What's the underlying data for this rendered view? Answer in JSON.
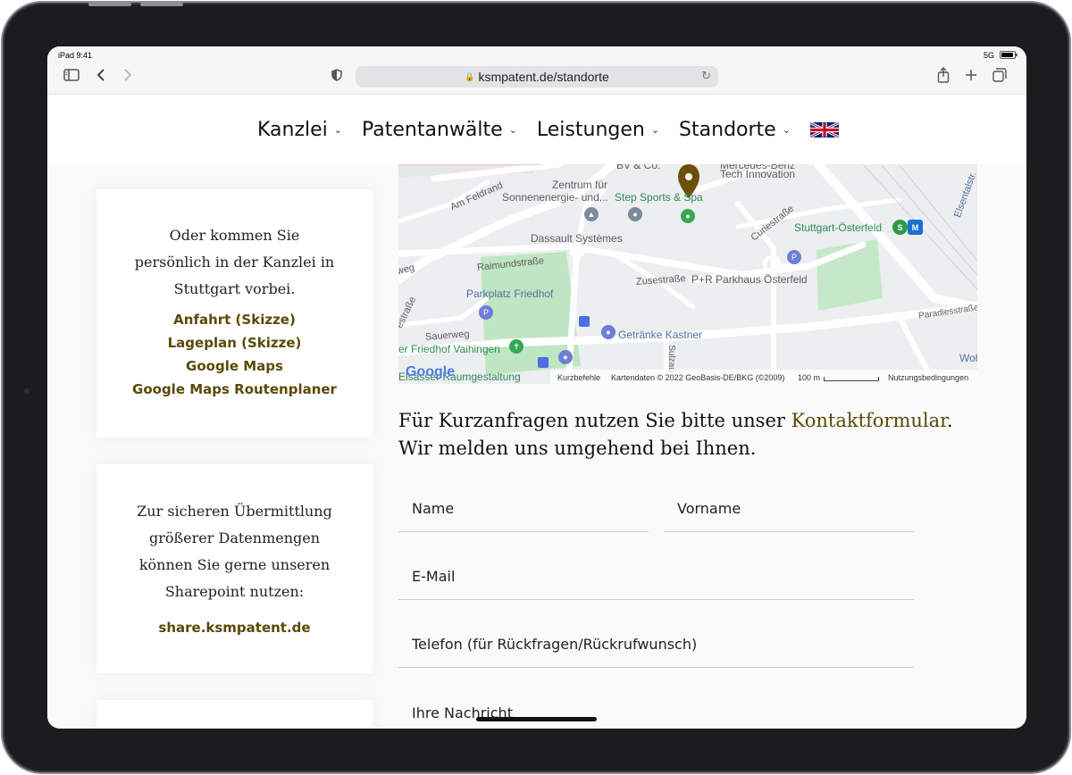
{
  "status": {
    "time": "iPad 9:41",
    "network": "5G"
  },
  "browser": {
    "url": "ksmpatent.de/standorte"
  },
  "nav": {
    "items": [
      {
        "label": "Kanzlei"
      },
      {
        "label": "Patentanwälte"
      },
      {
        "label": "Leistungen"
      },
      {
        "label": "Standorte"
      }
    ]
  },
  "visit_card": {
    "text": "Oder kommen Sie persönlich in der Kanzlei in Stuttgart vorbei.",
    "links": [
      "Anfahrt (Skizze)",
      "Lageplan (Skizze)",
      "Google Maps",
      "Google Maps Routenplaner"
    ]
  },
  "share_card": {
    "text": "Zur sicheren Übermittlung größerer Datenmengen können Sie gerne unseren Sharepoint nutzen:",
    "link": "share.ksmpatent.de"
  },
  "map": {
    "labels": {
      "bv": "BV & Co.",
      "mercedes": "Mercedes-Benz",
      "tech": "Tech Innovation",
      "zentrum1": "Zentrum für",
      "zentrum2": "Sonnenenergie- und...",
      "step": "Step Sports & Spa",
      "feldrand": "Am Feldrand",
      "curie": "Curiestraße",
      "elsental": "Elsentalstr.",
      "dassault": "Dassault Systèmes",
      "osterfeld": "Stuttgart-Österfeld",
      "raimund": "Raimundstraße",
      "zuse": "Zusestraße",
      "parkhaus": "P+R Parkhaus Österfeld",
      "parkplatz": "Parkplatz Friedhof",
      "paradies": "Paradiesstraße",
      "sauerweg": "Sauerweg",
      "getraenke": "Getränke Kastner",
      "friedhof": "er Friedhof Vaihingen",
      "sulzau": "Sulzau",
      "wohnm": "Wohnm",
      "raumgestaltung": "Elsässer Raumgestaltung",
      "weg": "weg",
      "estrasse": "estraße"
    },
    "footer": {
      "brand": "Google",
      "shortcuts": "Kurzbefehle",
      "attribution": "Kartendaten © 2022 GeoBasis-DE/BKG (©2009)",
      "scale": "100 m",
      "terms": "Nutzungsbedingungen"
    }
  },
  "contact": {
    "intro_before": "Für Kurzanfragen nutzen Sie bitte unser ",
    "intro_link": "Kontaktformular",
    "intro_after": ".",
    "line2": "Wir melden uns umgehend bei Ihnen.",
    "fields": {
      "name": "Name",
      "vorname": "Vorname",
      "email": "E-Mail",
      "telefon": "Telefon (für Rückfragen/Rückrufwunsch)",
      "nachricht": "Ihre Nachricht"
    }
  }
}
